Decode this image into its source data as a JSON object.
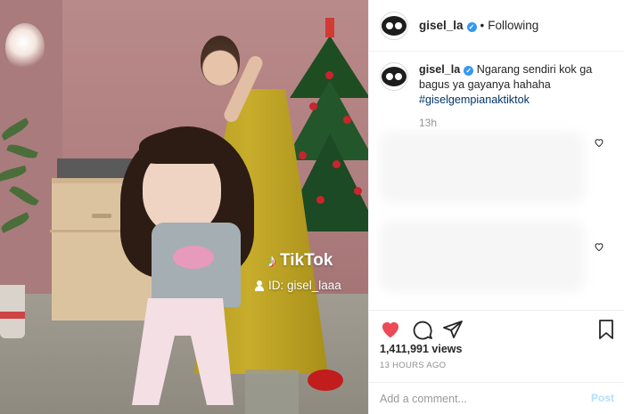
{
  "post": {
    "username": "gisel_la",
    "verified": true,
    "follow_status": "Following",
    "separator": "•",
    "caption_text": "Ngarang sendiri kok ga bagus ya gayanya hahaha",
    "hashtag": "#giselgempianaktiktok",
    "caption_age": "13h",
    "views": "1,411,991 views",
    "posted": "13 HOURS AGO"
  },
  "video": {
    "watermark_brand": "TikTok",
    "watermark_id": "ID: gisel_laaa"
  },
  "actions": {
    "like_icon": "heart-filled-icon",
    "comment_icon": "comment-icon",
    "share_icon": "share-icon",
    "save_icon": "bookmark-icon",
    "like_color": "#ed4956"
  },
  "comment": {
    "placeholder": "Add a comment...",
    "post_label": "Post"
  }
}
